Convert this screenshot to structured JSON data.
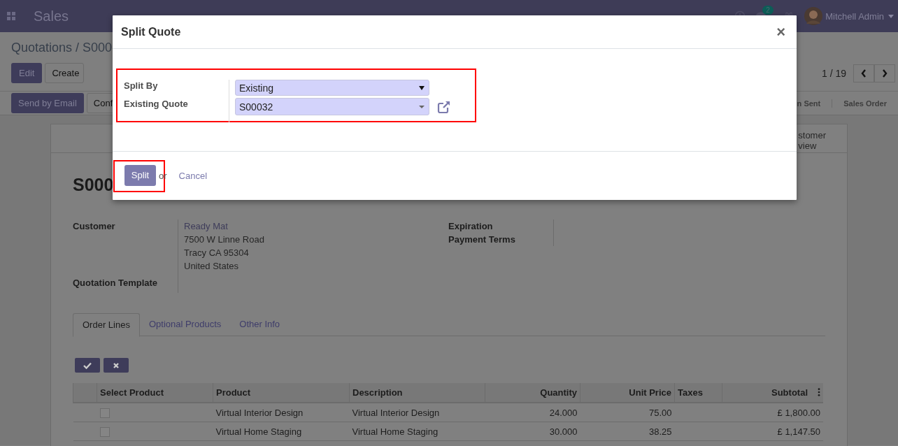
{
  "navbar": {
    "app": "Sales",
    "chat_count": "2",
    "user": "Mitchell Admin"
  },
  "breadcrumb": "Quotations / S000",
  "buttons": [
    "Edit",
    "Create"
  ],
  "pager": "1 / 19",
  "actions": [
    "Send by Email",
    "Conf"
  ],
  "status_steps": [
    "n Sent",
    "Sales Order"
  ],
  "smart_button": [
    "stomer",
    "view"
  ],
  "title": "S000",
  "left_group": [
    {
      "label": "Customer",
      "lines": [
        "Ready Mat",
        "7500 W Linne Road",
        "Tracy CA 95304",
        "United States"
      ]
    },
    {
      "label": "Quotation Template"
    }
  ],
  "right_group": [
    {
      "label": "Expiration"
    },
    {
      "label": "Payment Terms"
    }
  ],
  "tabs": [
    {
      "label": "Order Lines",
      "selected": true
    },
    {
      "label": "Optional Products",
      "selected": false
    },
    {
      "label": "Other Info",
      "selected": false
    }
  ],
  "table": {
    "columns": [
      "Select Product",
      "Product",
      "Description",
      "Quantity",
      "Unit Price",
      "Taxes",
      "Subtotal"
    ],
    "rows": [
      {
        "checked": false,
        "cells": [
          "",
          "Virtual Interior Design",
          "Virtual Interior Design",
          "24.000",
          "75.00",
          "",
          "£ 1,800.00"
        ]
      },
      {
        "checked": false,
        "cells": [
          "",
          "Virtual Home Staging",
          "Virtual Home Staging",
          "30.000",
          "38.25",
          "",
          "£ 1,147.50"
        ]
      }
    ]
  },
  "dialog": {
    "title": "Split Quote",
    "close": "×",
    "fields_highlighted": true,
    "fields": [
      {
        "label": "Split By",
        "value": "Existing",
        "kind": "select"
      },
      {
        "label": "Existing Quote",
        "value": "S00032",
        "kind": "many2one"
      }
    ],
    "primary": {
      "label": "Split",
      "highlighted": true
    },
    "or": "or",
    "cancel": "Cancel"
  }
}
